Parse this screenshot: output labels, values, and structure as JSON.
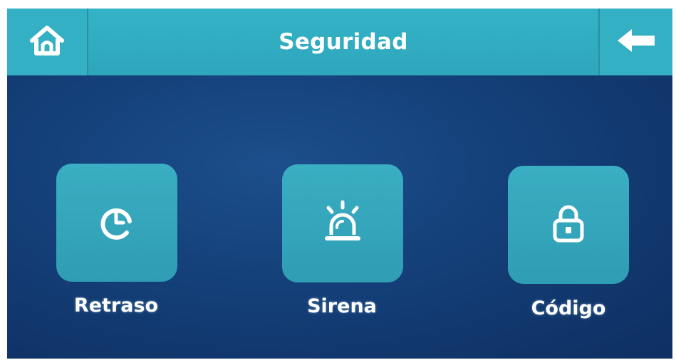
{
  "header": {
    "title": "Seguridad",
    "home_icon": "home-icon",
    "back_icon": "arrow-left-icon"
  },
  "tiles": [
    {
      "label": "Retraso",
      "icon": "clock-icon"
    },
    {
      "label": "Sirena",
      "icon": "siren-icon"
    },
    {
      "label": "Código",
      "icon": "lock-icon"
    }
  ],
  "colors": {
    "header_bg": "#33b0c4",
    "tile_bg": "#34a8bd",
    "screen_bg": "#143f78",
    "text": "#ffffff"
  }
}
